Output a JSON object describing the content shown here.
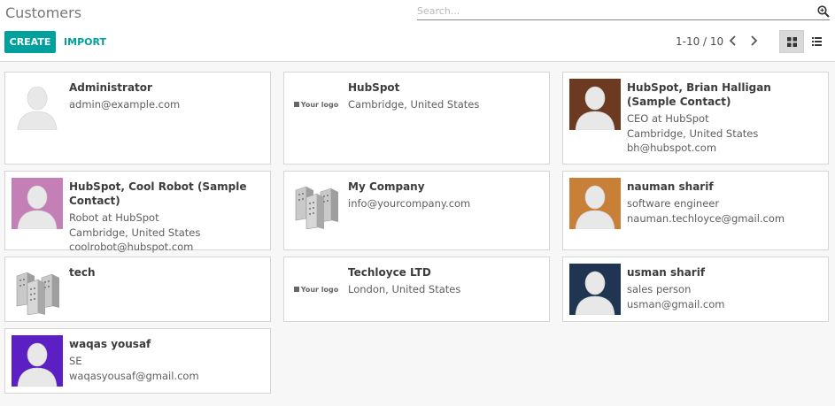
{
  "page": {
    "title": "Customers"
  },
  "search": {
    "placeholder": "Search..."
  },
  "toolbar": {
    "create_label": "CREATE",
    "import_label": "IMPORT"
  },
  "pager": {
    "value": "1-10 / 10"
  },
  "icons": {
    "search": "search-plus-icon",
    "prev": "chevron-left-icon",
    "next": "chevron-right-icon",
    "kanban": "grid-icon",
    "list": "list-icon"
  },
  "colors": {
    "accent": "#00a09d"
  },
  "logo_placeholder": "Your logo",
  "cards": [
    {
      "name": "Administrator",
      "lines": [
        "admin@example.com"
      ],
      "image": "avatar-placeholder"
    },
    {
      "name": "HubSpot",
      "lines": [
        "Cambridge, United States"
      ],
      "image": "your-logo"
    },
    {
      "name": "HubSpot, Brian Halligan (Sample Contact)",
      "lines": [
        "CEO at HubSpot",
        "Cambridge, United States",
        "bh@hubspot.com"
      ],
      "image": "avatar",
      "avatar_color": "#6b3a20"
    },
    {
      "name": "HubSpot, Cool Robot (Sample Contact)",
      "lines": [
        "Robot at HubSpot",
        "Cambridge, United States",
        "coolrobot@hubspot.com"
      ],
      "image": "avatar",
      "avatar_color": "#c47fb6"
    },
    {
      "name": "My Company",
      "lines": [
        "info@yourcompany.com"
      ],
      "image": "company-buildings"
    },
    {
      "name": "nauman sharif",
      "lines": [
        "software engineer",
        "nauman.techloyce@gmail.com"
      ],
      "image": "avatar",
      "avatar_color": "#c88038"
    },
    {
      "name": "tech",
      "lines": [],
      "image": "company-buildings"
    },
    {
      "name": "Techloyce LTD",
      "lines": [
        "London, United States"
      ],
      "image": "your-logo"
    },
    {
      "name": "usman sharif",
      "lines": [
        "sales person",
        "usman@gmail.com"
      ],
      "image": "avatar",
      "avatar_color": "#1f3552"
    },
    {
      "name": "waqas yousaf",
      "lines": [
        "SE",
        "waqasyousaf@gmail.com"
      ],
      "image": "avatar",
      "avatar_color": "#5b1fc4"
    }
  ]
}
